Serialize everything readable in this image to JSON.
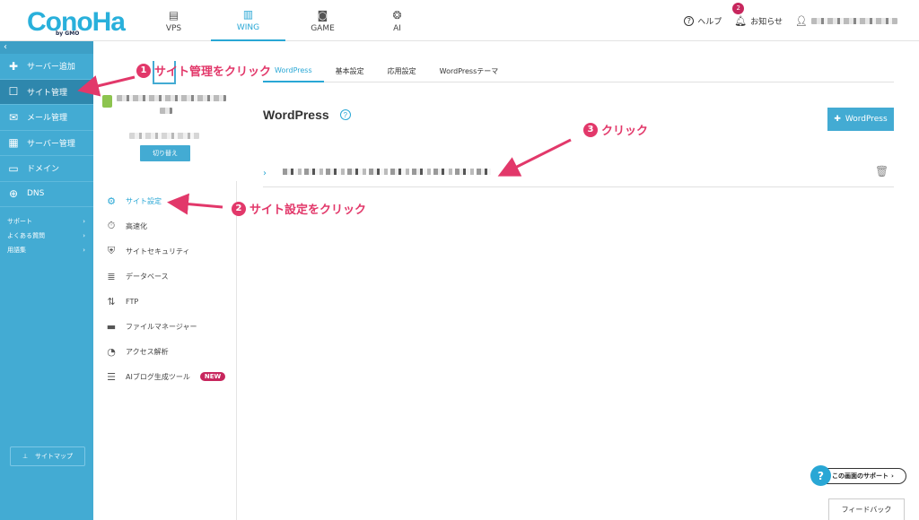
{
  "header": {
    "logo": "ConoHa",
    "logo_sub": "by GMO",
    "nav": [
      {
        "label": "VPS",
        "icon": "server-icon"
      },
      {
        "label": "WING",
        "icon": "wing-icon",
        "active": true
      },
      {
        "label": "GAME",
        "icon": "gamepad-icon"
      },
      {
        "label": "AI",
        "icon": "brain-icon"
      }
    ],
    "help": "ヘルプ",
    "notifications": "お知らせ",
    "notification_count": "2"
  },
  "sidebar": {
    "items": [
      {
        "label": "サーバー追加",
        "icon": "plus-icon"
      },
      {
        "label": "サイト管理",
        "icon": "site-icon",
        "active": true
      },
      {
        "label": "メール管理",
        "icon": "mail-icon"
      },
      {
        "label": "サーバー管理",
        "icon": "server-icon"
      },
      {
        "label": "ドメイン",
        "icon": "domain-icon"
      },
      {
        "label": "DNS",
        "icon": "globe-icon"
      }
    ],
    "links": [
      {
        "label": "サポート"
      },
      {
        "label": "よくある質問"
      },
      {
        "label": "用語集"
      }
    ],
    "sitemap": "サイトマップ"
  },
  "site_panel": {
    "switch_label": "切り替え",
    "menu": [
      {
        "label": "サイト設定",
        "icon": "settings-icon",
        "active": true
      },
      {
        "label": "高速化",
        "icon": "stopwatch-icon"
      },
      {
        "label": "サイトセキュリティ",
        "icon": "shield-icon"
      },
      {
        "label": "データベース",
        "icon": "database-icon"
      },
      {
        "label": "FTP",
        "icon": "transfer-icon"
      },
      {
        "label": "ファイルマネージャー",
        "icon": "folder-icon"
      },
      {
        "label": "アクセス解析",
        "icon": "pie-chart-icon"
      },
      {
        "label": "AIブログ生成ツール",
        "icon": "document-icon",
        "badge": "NEW"
      }
    ]
  },
  "main": {
    "tabs": [
      {
        "label": "WordPress",
        "active": true
      },
      {
        "label": "基本設定"
      },
      {
        "label": "応用設定"
      },
      {
        "label": "WordPressテーマ"
      }
    ],
    "title": "WordPress",
    "add_button": "WordPress"
  },
  "footer": {
    "support": "この画面のサポート",
    "feedback": "フィードバック"
  },
  "annotations": [
    {
      "num": "1",
      "text": "サイト管理をクリック"
    },
    {
      "num": "2",
      "text": "サイト設定をクリック"
    },
    {
      "num": "3",
      "text": "クリック"
    }
  ],
  "colors": {
    "accent": "#43abd3",
    "annotation": "#e2386a",
    "badge": "#c7265d"
  }
}
